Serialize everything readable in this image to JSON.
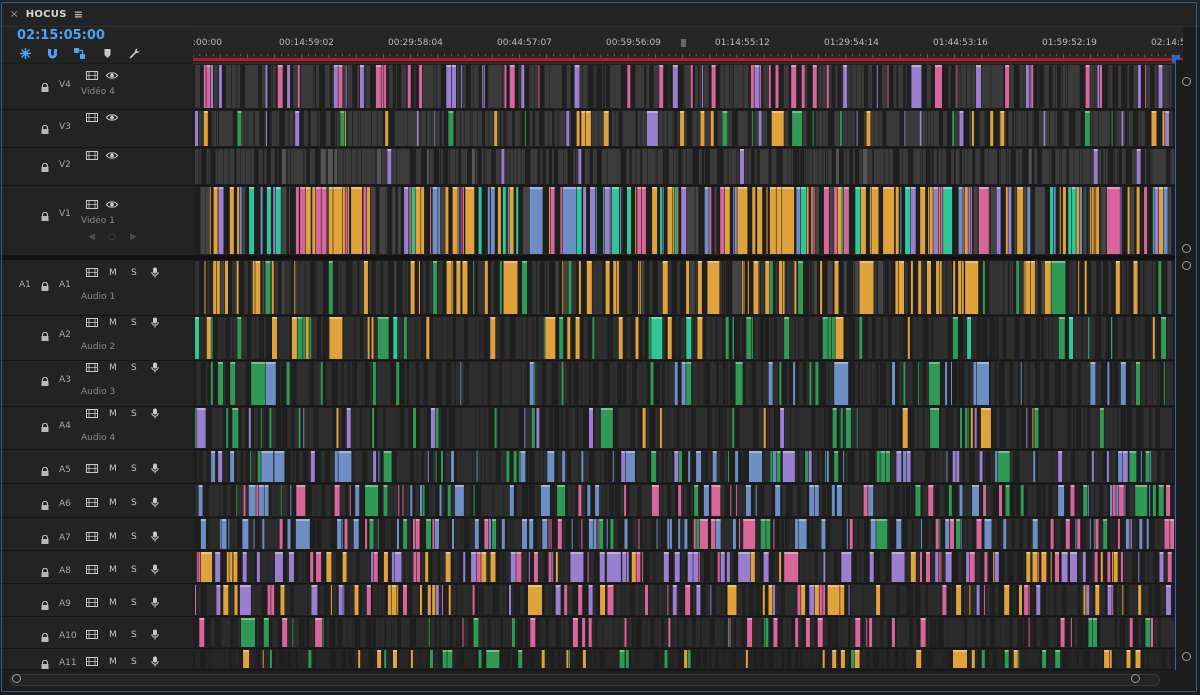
{
  "panel": {
    "tab_title": "HOCUS",
    "close_glyph": "×",
    "menu_glyph": "≡",
    "timecode": "02:15:05:00"
  },
  "toolbar": {
    "icons": [
      "insert-overwrite-icon",
      "snap-icon",
      "linked-selection-icon",
      "add-marker-icon",
      "timeline-settings-icon"
    ]
  },
  "ruler": {
    "labels": [
      ":00:00",
      "00:14:59:02",
      "00:29:58:04",
      "00:44:57:07",
      "00:59:56:09",
      "01:14:55:12",
      "01:29:54:14",
      "01:44:53:16",
      "01:59:52:19",
      "02:14:5"
    ]
  },
  "video_tracks": [
    {
      "id": "V4",
      "label": "Vidéo 4"
    },
    {
      "id": "V3",
      "label": ""
    },
    {
      "id": "V2",
      "label": ""
    },
    {
      "id": "V1",
      "label": "Vidéo 1"
    }
  ],
  "audio_tracks": [
    {
      "id": "A1",
      "label": "Audio 1",
      "source": "A1"
    },
    {
      "id": "A2",
      "label": "Audio 2",
      "source": ""
    },
    {
      "id": "A3",
      "label": "Audio 3",
      "source": ""
    },
    {
      "id": "A4",
      "label": "Audio 4",
      "source": ""
    },
    {
      "id": "A5",
      "label": "",
      "source": ""
    },
    {
      "id": "A6",
      "label": "",
      "source": ""
    },
    {
      "id": "A7",
      "label": "",
      "source": ""
    },
    {
      "id": "A8",
      "label": "",
      "source": ""
    },
    {
      "id": "A9",
      "label": "",
      "source": ""
    },
    {
      "id": "A10",
      "label": "",
      "source": ""
    },
    {
      "id": "A11",
      "label": "",
      "source": ""
    }
  ],
  "track_buttons": {
    "mute": "M",
    "solo": "S"
  },
  "keyframe_nav": {
    "prev": "◀",
    "add": "○",
    "next": "▶"
  },
  "colors": {
    "accent": "#4ba3f5",
    "ruler_red": "#b21c1c",
    "clip_orange": "#e0a33c",
    "clip_pink": "#d9669b",
    "clip_purple": "#9a7fd0",
    "clip_green": "#2f9a55",
    "clip_teal": "#2ec79a",
    "clip_blue": "#6d8fc6",
    "clip_gray": "#3a3a3a"
  }
}
